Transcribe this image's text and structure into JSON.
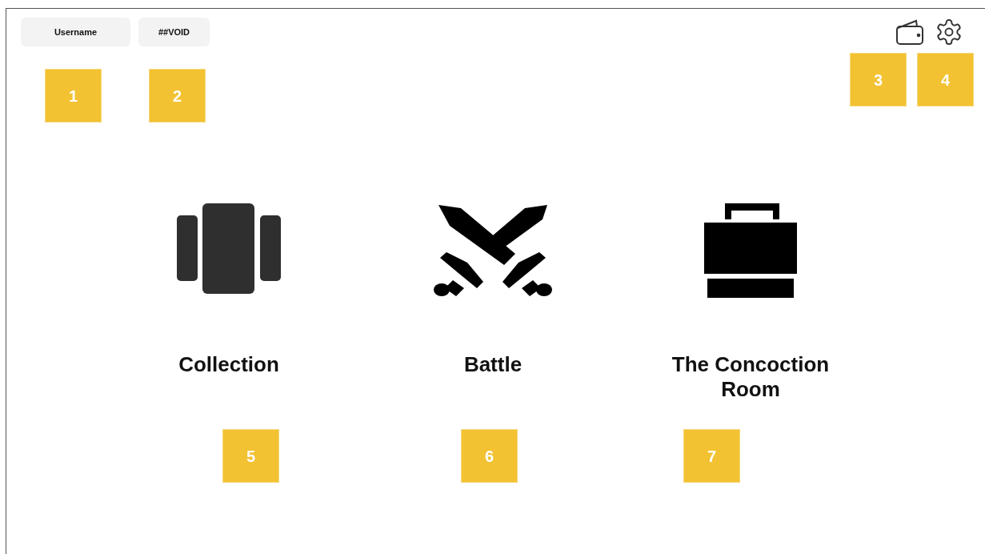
{
  "top_buttons": [
    {
      "label": "Username"
    },
    {
      "label": "##VOID"
    }
  ],
  "top_icons": [
    {
      "kind": "wallet"
    },
    {
      "kind": "settings"
    }
  ],
  "menu": [
    {
      "kind": "collection",
      "label": "Collection"
    },
    {
      "kind": "battle",
      "label": "Battle"
    },
    {
      "kind": "concoction",
      "label": "The Concoction Room"
    }
  ],
  "annotations": [
    {
      "label": "1"
    },
    {
      "label": "2"
    },
    {
      "label": "3"
    },
    {
      "label": "4"
    },
    {
      "label": "5"
    },
    {
      "label": "6"
    },
    {
      "label": "7"
    }
  ]
}
